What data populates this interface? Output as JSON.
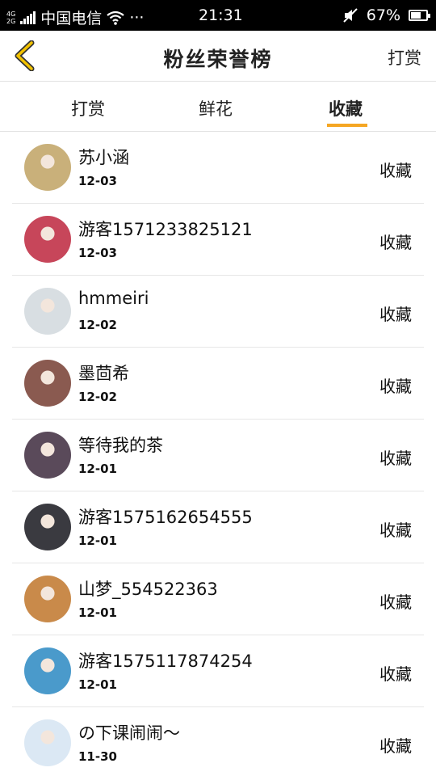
{
  "status_bar": {
    "network_top": "4G",
    "network_bottom": "2G",
    "carrier": "中国电信",
    "dots": "···",
    "time": "21:31",
    "battery": "67%",
    "battery_level": 0.67
  },
  "nav": {
    "title": "粉丝荣誉榜",
    "right_button": "打赏"
  },
  "tabs": [
    {
      "label": "打赏"
    },
    {
      "label": "鲜花"
    },
    {
      "label": "收藏"
    }
  ],
  "active_tab": 2,
  "fans": [
    {
      "name": "苏小涵",
      "date": "12-03",
      "action": "收藏",
      "avatar_color": "#c9b07a"
    },
    {
      "name": "游客1571233825121",
      "date": "12-03",
      "action": "收藏",
      "avatar_color": "#c7465a"
    },
    {
      "name": "hmmeiri",
      "date": "12-02",
      "action": "收藏",
      "avatar_color": "#d8dee2"
    },
    {
      "name": "墨茴希",
      "date": "12-02",
      "action": "收藏",
      "avatar_color": "#8a5a50"
    },
    {
      "name": "等待我的茶",
      "date": "12-01",
      "action": "收藏",
      "avatar_color": "#5a4a5a"
    },
    {
      "name": "游客1575162654555",
      "date": "12-01",
      "action": "收藏",
      "avatar_color": "#3a3a40"
    },
    {
      "name": "山梦_554522363",
      "date": "12-01",
      "action": "收藏",
      "avatar_color": "#c98a4a"
    },
    {
      "name": "游客1575117874254",
      "date": "12-01",
      "action": "收藏",
      "avatar_color": "#4a9acb"
    },
    {
      "name": "の下课闹闹～",
      "date": "11-30",
      "action": "收藏",
      "avatar_color": "#dbe8f4"
    }
  ],
  "colors": {
    "accent": "#f5a623",
    "status_bar_bg": "#000000",
    "back_arrow": "#f2c200"
  }
}
